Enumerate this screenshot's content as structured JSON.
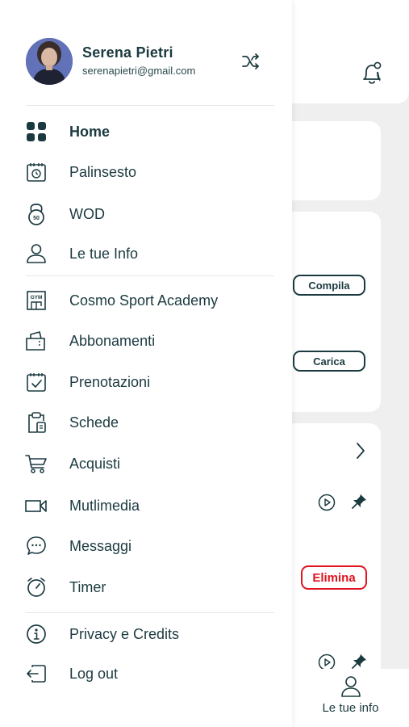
{
  "user": {
    "name": "Serena Pietri",
    "email": "serenapietri@gmail.com"
  },
  "menu": {
    "main": [
      {
        "label": "Home",
        "icon": "grid-icon",
        "active": true
      },
      {
        "label": "Palinsesto",
        "icon": "calendar-clock-icon"
      },
      {
        "label": "WOD",
        "icon": "kettlebell-icon"
      },
      {
        "label": "Le tue Info",
        "icon": "user-icon"
      }
    ],
    "gym": [
      {
        "label": "Cosmo Sport Academy",
        "icon": "gym-icon"
      },
      {
        "label": "Abbonamenti",
        "icon": "ticket-icon"
      },
      {
        "label": "Prenotazioni",
        "icon": "calendar-check-icon"
      },
      {
        "label": "Schede",
        "icon": "clipboard-icon"
      },
      {
        "label": "Acquisti",
        "icon": "cart-icon"
      },
      {
        "label": "Mutlimedia",
        "icon": "video-icon"
      },
      {
        "label": "Messaggi",
        "icon": "chat-icon"
      },
      {
        "label": "Timer",
        "icon": "timer-icon"
      }
    ],
    "footer": [
      {
        "label": "Privacy e Credits",
        "icon": "info-icon"
      },
      {
        "label": "Log out",
        "icon": "logout-icon"
      }
    ]
  },
  "background": {
    "compila": "Compila",
    "carica": "Carica",
    "elimina": "Elimina",
    "bottom_nav_label": "Le tue info"
  },
  "colors": {
    "primary": "#1b3a40",
    "danger": "#e0141e",
    "background": "#efefef"
  }
}
